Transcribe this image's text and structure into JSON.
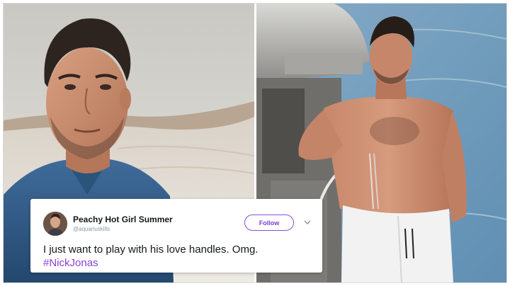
{
  "tweet": {
    "author_name": "Peachy Hot Girl Summer",
    "author_handle": "@aquariuskills",
    "follow_label": "Follow",
    "text": "I just want to play with his love handles. Omg.",
    "hashtag": "#NickJonas"
  },
  "colors": {
    "follow_accent": "#8a4fd6",
    "hashtag": "#8a3fd6",
    "sea": "#6f9ab8"
  },
  "icons": [
    "chevron-down-icon",
    "avatar"
  ]
}
